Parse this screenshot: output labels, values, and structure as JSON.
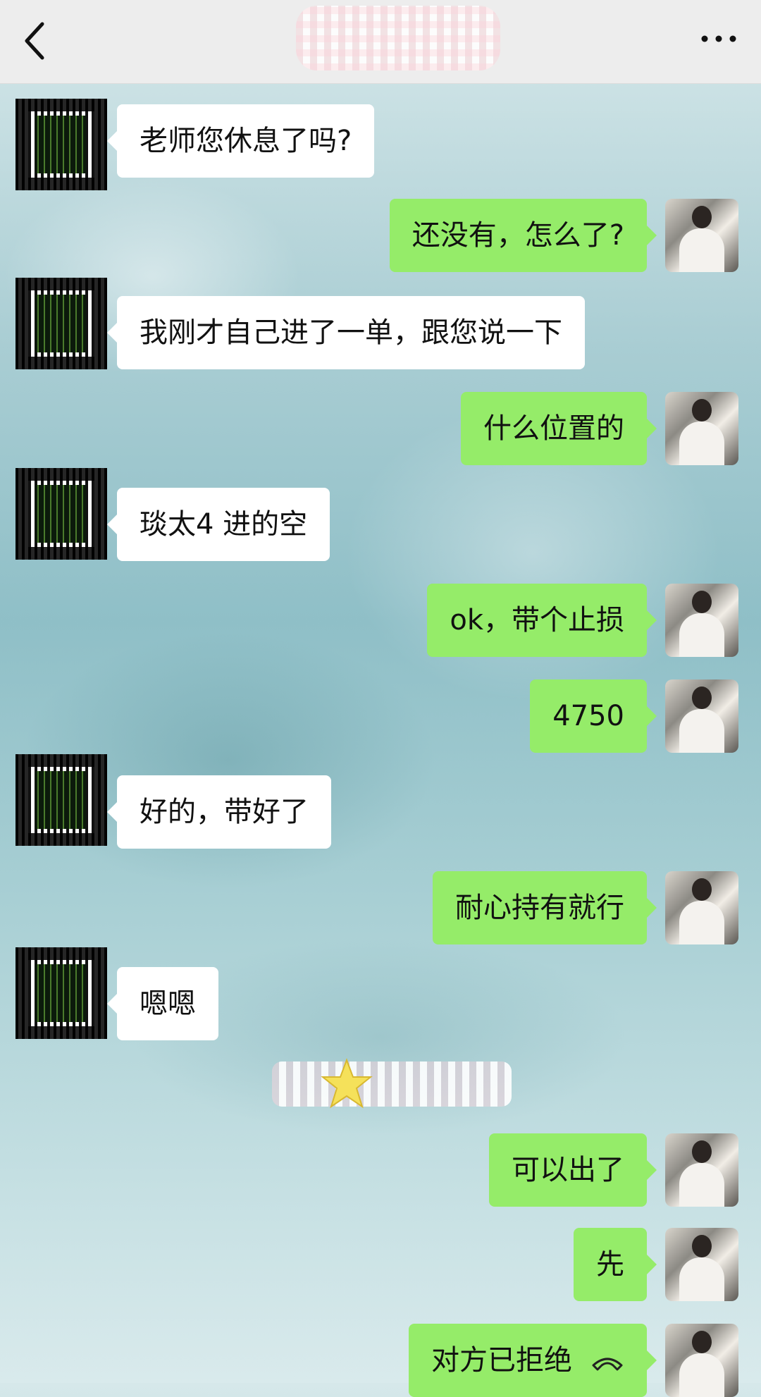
{
  "header": {
    "back_icon": "chevron-left-icon",
    "more_icon": "ellipsis-icon"
  },
  "colors": {
    "sent_bubble": "#95ec69",
    "received_bubble": "#ffffff",
    "topbar": "#ededed"
  },
  "messages": [
    {
      "side": "left",
      "text": "老师您休息了吗?"
    },
    {
      "side": "right",
      "text": "还没有，怎么了?"
    },
    {
      "side": "left",
      "text": "我刚才自己进了一单，跟您说一下"
    },
    {
      "side": "right",
      "text": "什么位置的"
    },
    {
      "side": "left",
      "text": "琰太4 进的空"
    },
    {
      "side": "right",
      "text": "ok，带个止损"
    },
    {
      "side": "right",
      "text": "4750"
    },
    {
      "side": "left",
      "text": "好的，带好了"
    },
    {
      "side": "right",
      "text": "耐心持有就行"
    },
    {
      "side": "left",
      "text": "嗯嗯"
    },
    {
      "side": "right",
      "text": "可以出了"
    },
    {
      "side": "right",
      "text": "先"
    },
    {
      "side": "right",
      "text": "对方已拒绝",
      "icon": "phone-hangup-icon"
    }
  ]
}
